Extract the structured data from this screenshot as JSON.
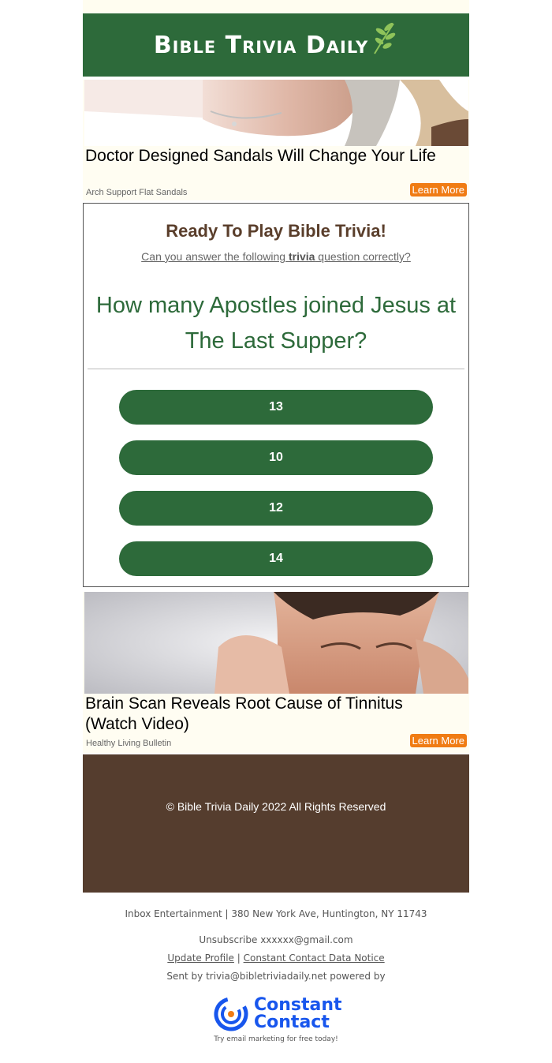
{
  "header": {
    "logo_text": "Bible Trivia Daily"
  },
  "ad1": {
    "title": "Doctor Designed Sandals Will Change Your Life",
    "source": "Arch Support Flat Sandals",
    "cta": "Learn More"
  },
  "quiz": {
    "heading": "Ready To Play Bible Trivia!",
    "subtitle_before": "Can you answer the following ",
    "subtitle_bold": "trivia",
    "subtitle_after": " question correctly?",
    "question": "How many Apostles joined Jesus at The Last Supper?",
    "answers": [
      "13",
      "10",
      "12",
      "14"
    ]
  },
  "ad2": {
    "title": "Brain Scan Reveals Root Cause of Tinnitus (Watch Video)",
    "source": "Healthy Living Bulletin",
    "cta": "Learn More"
  },
  "footer": {
    "copyright": "© Bible Trivia Daily 2022 All Rights Reserved"
  },
  "legal": {
    "address": "Inbox Entertainment | 380 New York Ave, Huntington, NY 11743",
    "unsubscribe": "Unsubscribe xxxxxx@gmail.com",
    "update_profile": "Update Profile",
    "separator": " | ",
    "data_notice": "Constant Contact Data Notice",
    "sent_by": "Sent by trivia@bibletriviadaily.net powered by"
  },
  "brand": {
    "cc_line1": "Constant",
    "cc_line2": "Contact",
    "cc_tagline": "Try email marketing for free today!"
  },
  "colors": {
    "primary_green": "#2d6a3a",
    "footer_brown": "#553d2e",
    "cta_orange": "#f07c14",
    "cc_blue": "#1856ed"
  }
}
